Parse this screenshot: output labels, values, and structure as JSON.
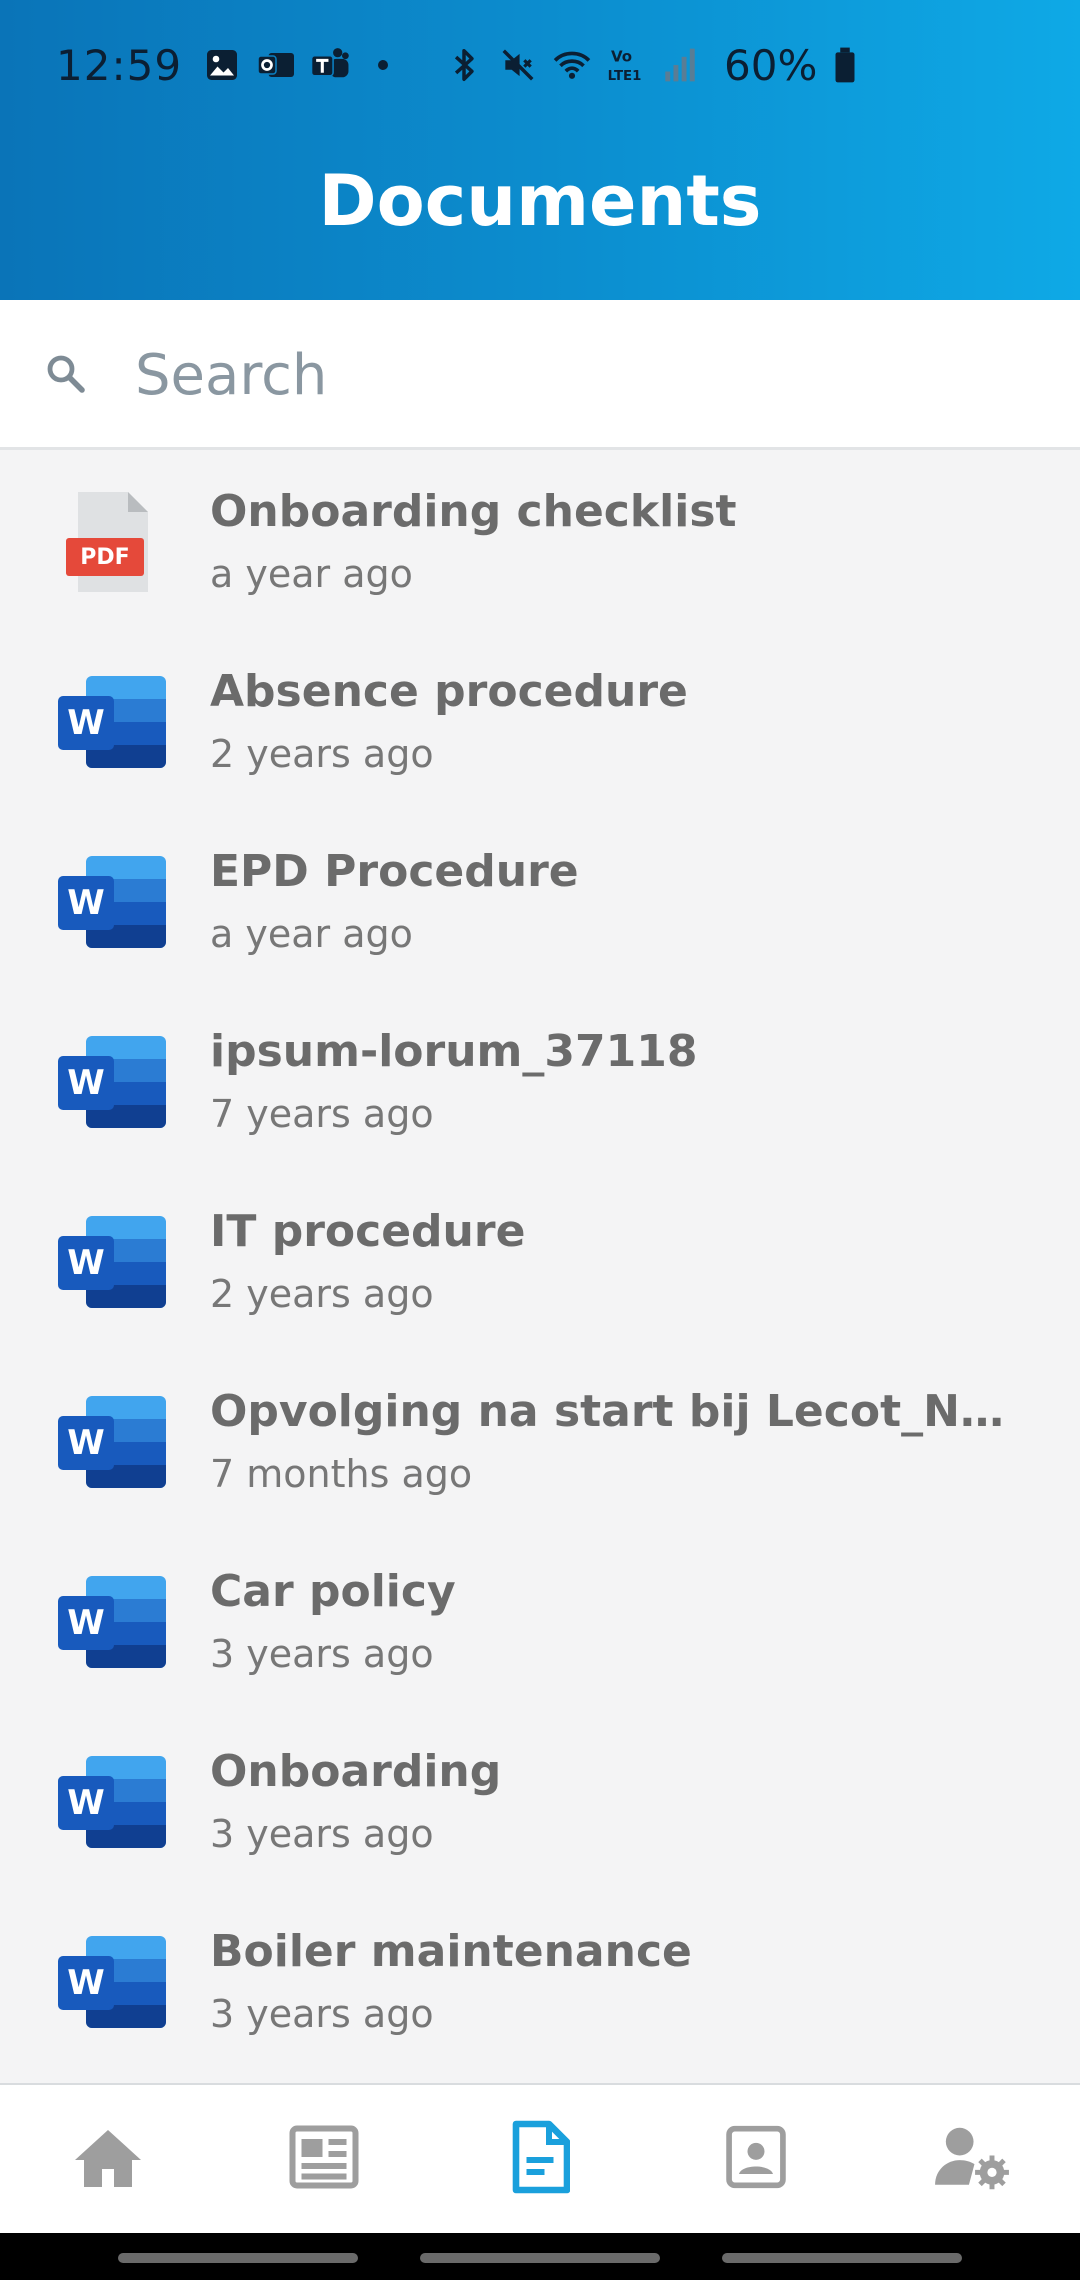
{
  "status_bar": {
    "time": "12:59",
    "battery": "60%",
    "icons": [
      "gallery-icon",
      "outlook-icon",
      "teams-icon",
      "bluetooth-icon",
      "mute-icon",
      "wifi-icon",
      "volte-icon",
      "signal-icon",
      "battery-icon"
    ]
  },
  "header": {
    "title": "Documents"
  },
  "search": {
    "placeholder": "Search",
    "value": ""
  },
  "documents": [
    {
      "title": "Onboarding checklist",
      "time": "a year ago",
      "type": "pdf"
    },
    {
      "title": "Absence procedure",
      "time": "2 years ago",
      "type": "word"
    },
    {
      "title": "EPD Procedure",
      "time": "a year ago",
      "type": "word"
    },
    {
      "title": "ipsum-lorum_37118",
      "time": "7 years ago",
      "type": "word"
    },
    {
      "title": "IT procedure",
      "time": "2 years ago",
      "type": "word"
    },
    {
      "title": "Opvolging na start bij Lecot_N...",
      "time": "7 months ago",
      "type": "word"
    },
    {
      "title": "Car policy",
      "time": "3 years ago",
      "type": "word"
    },
    {
      "title": "Onboarding",
      "time": "3 years ago",
      "type": "word"
    },
    {
      "title": "Boiler maintenance",
      "time": "3 years ago",
      "type": "word"
    }
  ],
  "pdf_badge": "PDF",
  "word_letter": "W",
  "bottom_nav": [
    {
      "icon": "home-icon",
      "active": false
    },
    {
      "icon": "news-icon",
      "active": false
    },
    {
      "icon": "document-icon",
      "active": true
    },
    {
      "icon": "contact-card-icon",
      "active": false
    },
    {
      "icon": "user-settings-icon",
      "active": false
    }
  ],
  "colors": {
    "header_start": "#0a74b8",
    "header_end": "#0ea9e6",
    "active_nav": "#1aa0dc",
    "inactive_nav": "#9e9e9e",
    "pdf_red": "#e5493a",
    "word_blue": "#185abd"
  }
}
